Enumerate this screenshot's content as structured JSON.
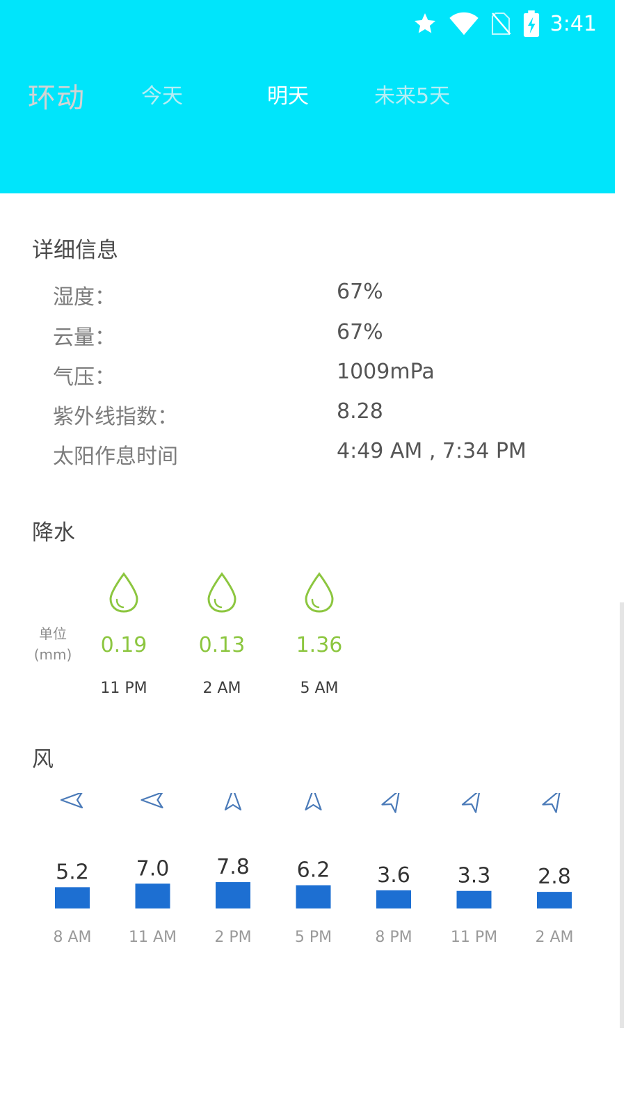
{
  "status_bar": {
    "time": "3:41",
    "icons": [
      "star-icon",
      "wifi-icon",
      "no-sim-icon",
      "battery-charging-icon"
    ]
  },
  "app": {
    "brand": "环动",
    "tabs": [
      {
        "label": "今天",
        "active": false
      },
      {
        "label": "明天",
        "active": true
      },
      {
        "label": "未来5天",
        "active": false
      }
    ]
  },
  "details": {
    "title": "详细信息",
    "rows": [
      {
        "label": "湿度：",
        "value": "67%"
      },
      {
        "label": "云量：",
        "value": "67%"
      },
      {
        "label": "气压：",
        "value": "1009mPa"
      },
      {
        "label": "紫外线指数：",
        "value": "8.28"
      },
      {
        "label": "太阳作息时间",
        "value": "4:49 AM , 7:34 PM"
      }
    ]
  },
  "precipitation": {
    "title": "降水",
    "unit_line1": "单位",
    "unit_line2": "(mm)",
    "icon": "water-drop-icon",
    "items": [
      {
        "value": "0.19",
        "time": "11 PM"
      },
      {
        "value": "0.13",
        "time": "2 AM"
      },
      {
        "value": "1.36",
        "time": "5 AM"
      }
    ]
  },
  "wind": {
    "title": "风",
    "icon": "navigation-arrow-icon"
  },
  "chart_data": {
    "type": "bar",
    "categories": [
      "8 AM",
      "11 AM",
      "2 PM",
      "5 PM",
      "8 PM",
      "11 PM",
      "2 AM"
    ],
    "values": [
      5.2,
      7.0,
      7.8,
      6.2,
      3.6,
      3.3,
      2.8
    ],
    "direction_deg": [
      -90,
      -90,
      0,
      0,
      30,
      30,
      30
    ],
    "ylim": [
      0,
      8
    ],
    "grid": false,
    "bar_color": "#1d6fd2",
    "value_label_color": "#333333",
    "tick_label_color": "#9a9a9a",
    "arrow_color": "#4a7ab8"
  },
  "colors": {
    "header": "#00e5fb",
    "precip_value": "#8cc63f",
    "drop_icon": "#8cc63f"
  }
}
